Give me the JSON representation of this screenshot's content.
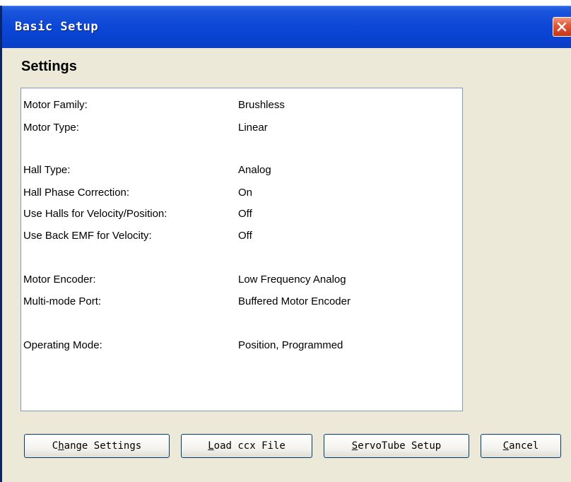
{
  "window": {
    "title": "Basic Setup",
    "close_icon": "close-x-icon"
  },
  "heading": "Settings",
  "settings": [
    {
      "label": "Motor Family:",
      "value": "Brushless"
    },
    {
      "label": "Motor Type:",
      "value": "Linear"
    },
    {
      "label": "Hall Type:",
      "value": "Analog"
    },
    {
      "label": "Hall Phase Correction:",
      "value": "On"
    },
    {
      "label": "Use Halls for Velocity/Position:",
      "value": "Off"
    },
    {
      "label": "Use Back EMF for Velocity:",
      "value": "Off"
    },
    {
      "label": "Motor Encoder:",
      "value": "Low Frequency Analog"
    },
    {
      "label": "Multi-mode Port:",
      "value": "Buffered Motor Encoder"
    },
    {
      "label": "Operating Mode:",
      "value": "Position, Programmed"
    }
  ],
  "buttons": {
    "change_settings": {
      "mnemonic": "h",
      "pre": "C",
      "post": "ange Settings"
    },
    "load_ccx": {
      "mnemonic": "L",
      "pre": "",
      "post": "oad ccx File"
    },
    "servotube": {
      "mnemonic": "S",
      "pre": "",
      "post": "ervoTube Setup"
    },
    "cancel": {
      "mnemonic": "C",
      "pre": "",
      "post": "ancel"
    }
  },
  "colors": {
    "titlebar": "#0842cf",
    "window_bg": "#ece9d8",
    "close_button": "#e2583a",
    "panel_border": "#7f9db9"
  }
}
